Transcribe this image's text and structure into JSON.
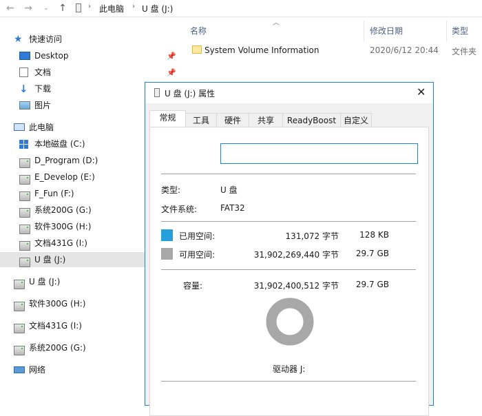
{
  "address": {
    "crumbs": [
      "此电脑",
      "U 盘 (J:)"
    ]
  },
  "nav": {
    "quick_access": "快速访问",
    "items": [
      {
        "label": "Desktop",
        "icon": "desktop-icon",
        "pinned": true
      },
      {
        "label": "文档",
        "icon": "documents-icon",
        "pinned": true
      },
      {
        "label": "下载",
        "icon": "download-icon",
        "pinned": false
      },
      {
        "label": "图片",
        "icon": "pictures-icon",
        "pinned": false
      }
    ],
    "this_pc": "此电脑",
    "drives": [
      {
        "label": "本地磁盘 (C:)",
        "icon": "windows-drive-icon"
      },
      {
        "label": "D_Program (D:)",
        "icon": "drive-icon"
      },
      {
        "label": "E_Develop (E:)",
        "icon": "drive-icon"
      },
      {
        "label": "F_Fun (F:)",
        "icon": "drive-icon"
      },
      {
        "label": "系统200G (G:)",
        "icon": "drive-icon"
      },
      {
        "label": "软件300G (H:)",
        "icon": "drive-icon"
      },
      {
        "label": "文档431G (I:)",
        "icon": "drive-icon"
      },
      {
        "label": "U 盘 (J:)",
        "icon": "usb-drive-icon",
        "selected": true
      }
    ],
    "root_drives": [
      {
        "label": "U 盘 (J:)",
        "icon": "usb-drive-icon"
      },
      {
        "label": "软件300G (H:)",
        "icon": "drive-icon"
      },
      {
        "label": "文档431G (I:)",
        "icon": "drive-icon"
      },
      {
        "label": "系统200G (G:)",
        "icon": "drive-icon"
      }
    ],
    "network": "网络"
  },
  "content": {
    "columns": {
      "name": "名称",
      "modified": "修改日期",
      "type": "类型"
    },
    "rows": [
      {
        "name": "System Volume Information",
        "modified": "2020/6/12 20:44",
        "type": "文件夹"
      }
    ]
  },
  "dialog": {
    "title": "U 盘 (J:) 属性",
    "tabs": [
      "常规",
      "工具",
      "硬件",
      "共享",
      "ReadyBoost",
      "自定义"
    ],
    "active_tab": "常规",
    "volume_label": "",
    "type_label": "类型:",
    "type_value": "U 盘",
    "fs_label": "文件系统:",
    "fs_value": "FAT32",
    "used_label": "已用空间:",
    "used_bytes": "131,072 字节",
    "used_size": "128 KB",
    "free_label": "可用空间:",
    "free_bytes": "31,902,269,440 字节",
    "free_size": "29.7 GB",
    "cap_label": "容量:",
    "cap_bytes": "31,902,400,512 字节",
    "cap_size": "29.7 GB",
    "drive_label": "驱动器 J:",
    "used_fraction": 4.1e-06,
    "colors": {
      "used": "#26a0da",
      "free": "#a8a8a8",
      "accent": "#1883d7"
    }
  }
}
